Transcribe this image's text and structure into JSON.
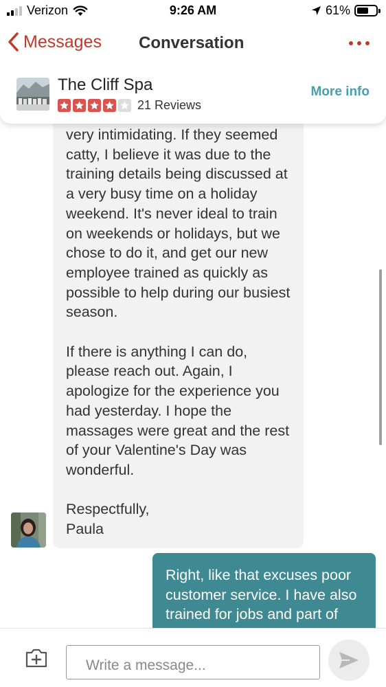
{
  "status_bar": {
    "carrier": "Verizon",
    "time": "9:26 AM",
    "battery_percent": "61%",
    "battery_level": 0.61,
    "signal_bars_filled": 2,
    "signal_bars_total": 4,
    "icons": [
      "signal-icon",
      "wifi-icon",
      "location-arrow-icon",
      "battery-icon"
    ]
  },
  "nav": {
    "back_label": "Messages",
    "title": "Conversation",
    "more_icon": "more-dots-icon"
  },
  "business": {
    "name": "The Cliff Spa",
    "rating_stars": 4,
    "max_stars": 5,
    "reviews_label": "21 Reviews",
    "more_info_label": "More info"
  },
  "messages": [
    {
      "direction": "incoming",
      "text": "very intimidating. If they seemed catty, I believe it was due to the training details being discussed at a very busy time on a holiday weekend. It's never ideal to train on weekends or holidays, but we chose to do it, and get our new employee trained as quickly as possible to help during our busiest season.\n\nIf there is anything I can do, please reach out. Again, I apologize for the experience you had yesterday. I hope the massages were great and the rest of your Valentine's Day was wonderful.\n\nRespectfully,\nPaula"
    },
    {
      "direction": "outgoing",
      "text": "Right, like that excuses poor customer service. I have also trained for jobs and part of"
    }
  ],
  "composer": {
    "placeholder": "Write a message...",
    "attach_icon": "add-photo-icon",
    "send_icon": "send-icon"
  },
  "colors": {
    "accent_red": "#c0392b",
    "star_red": "#d9534f",
    "more_info_teal": "#4a9fae",
    "outgoing_bubble": "#3f8993",
    "incoming_bubble": "#f2f2f2"
  }
}
